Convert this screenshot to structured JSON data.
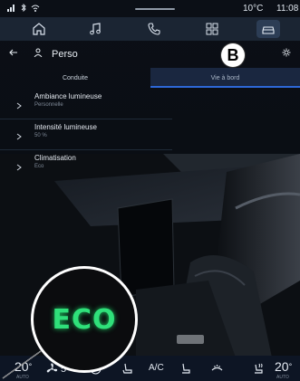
{
  "status_bar": {
    "temperature": "10°C",
    "time": "11:08"
  },
  "top_nav": {
    "items": [
      {
        "icon": "home-icon"
      },
      {
        "icon": "music-icon"
      },
      {
        "icon": "phone-icon"
      },
      {
        "icon": "apps-icon"
      },
      {
        "icon": "car-icon",
        "active": true
      }
    ]
  },
  "header": {
    "title": "Perso"
  },
  "tabs": [
    {
      "label": "Conduite"
    },
    {
      "label": "Vie à bord",
      "active": true
    }
  ],
  "settings_list": [
    {
      "label": "Ambiance lumineuse",
      "value": "Personnelle"
    },
    {
      "label": "Intensité lumineuse",
      "value": "50 %"
    },
    {
      "label": "Climatisation",
      "value": "Eco"
    }
  ],
  "callout": {
    "label": "B"
  },
  "zoom": {
    "text": "ECO"
  },
  "bottom_bar": {
    "temp_left": "20",
    "fan_speed": "5",
    "ac_label": "A/C",
    "temp_right": "20",
    "left_sub": "AUTO",
    "right_sub": "AUTO"
  },
  "colors": {
    "accent": "#2d68d8",
    "eco_green": "#2fe07a",
    "nav_bg": "#1b2533"
  }
}
